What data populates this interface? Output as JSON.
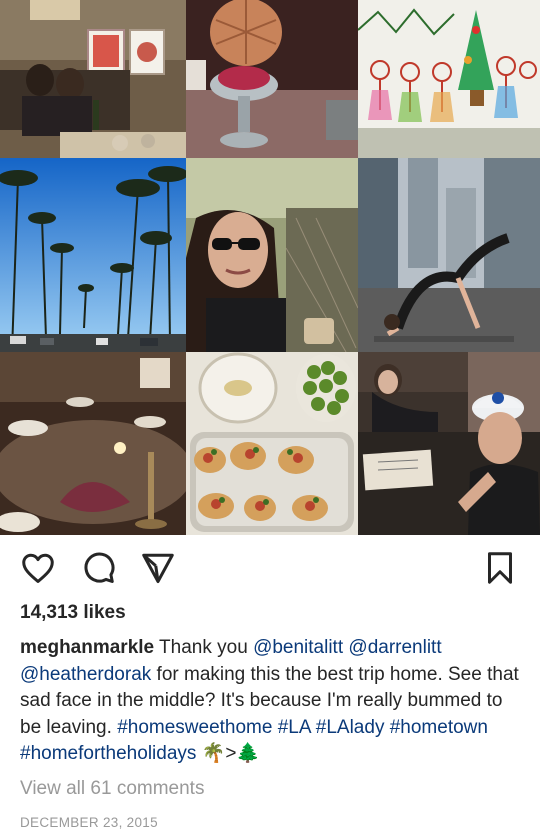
{
  "grid": {
    "tiles": [
      {
        "name": "photo-friends-on-couch"
      },
      {
        "name": "photo-waffle-dessert"
      },
      {
        "name": "photo-child-drawing"
      },
      {
        "name": "photo-palm-trees-street"
      },
      {
        "name": "photo-sunglasses-selfie"
      },
      {
        "name": "photo-yoga-pose"
      },
      {
        "name": "photo-dinner-table"
      },
      {
        "name": "photo-food-platter"
      },
      {
        "name": "photo-girls-at-table"
      }
    ]
  },
  "actions": {
    "like_icon": "heart-icon",
    "comment_icon": "comment-icon",
    "share_icon": "share-icon",
    "save_icon": "bookmark-icon"
  },
  "post": {
    "likes": "14,313 likes",
    "username": "meghanmarkle",
    "caption_text_1": " Thank you ",
    "mention_1": "@benitalitt",
    "caption_sep_1": " ",
    "mention_2": "@darrenlitt",
    "caption_sep_2": " ",
    "mention_3": "@heatherdorak",
    "caption_text_2": " for making this the best trip home. See that sad face in the middle? It's because I'm really bummed to be leaving. ",
    "hashtags": [
      "#homesweethome",
      "#LA",
      "#LAlady",
      "#hometown",
      "#homefortheholidays"
    ],
    "emoji_text": " 🌴>🌲",
    "comments_link": "View all 61 comments",
    "date": "DECEMBER 23, 2015"
  },
  "colors": {
    "text": "#262626",
    "mention": "#0b3a7a",
    "muted": "#999999"
  }
}
